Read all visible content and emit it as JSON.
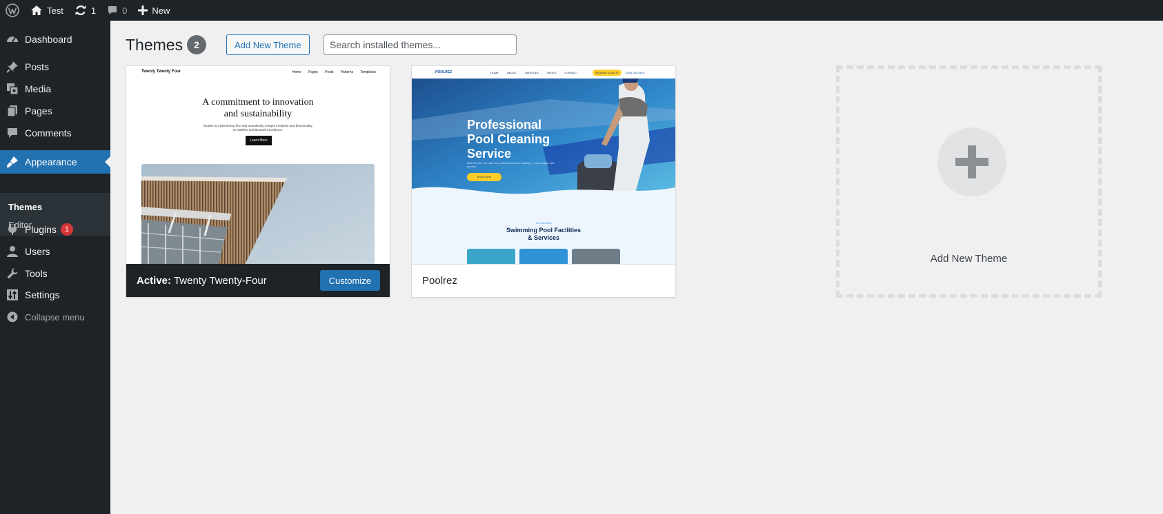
{
  "adminbar": {
    "site_name": "Test",
    "updates_count": "1",
    "comments_count": "0",
    "new_label": "New"
  },
  "sidebar": {
    "items": [
      {
        "label": "Dashboard",
        "icon": "dashboard-icon"
      },
      {
        "label": "Posts",
        "icon": "pushpin-icon"
      },
      {
        "label": "Media",
        "icon": "media-icon"
      },
      {
        "label": "Pages",
        "icon": "pages-icon"
      },
      {
        "label": "Comments",
        "icon": "comment-icon"
      },
      {
        "label": "Appearance",
        "icon": "paintbrush-icon"
      },
      {
        "label": "Plugins",
        "icon": "plug-icon",
        "badge": "1"
      },
      {
        "label": "Users",
        "icon": "user-icon"
      },
      {
        "label": "Tools",
        "icon": "wrench-icon"
      },
      {
        "label": "Settings",
        "icon": "settings-icon"
      }
    ],
    "submenu": [
      "Themes",
      "Editor"
    ],
    "collapse_label": "Collapse menu"
  },
  "header": {
    "title": "Themes",
    "count": "2",
    "add_button": "Add New Theme",
    "search_placeholder": "Search installed themes..."
  },
  "themes": [
    {
      "active_prefix": "Active:",
      "name": "Twenty Twenty-Four",
      "customize_label": "Customize",
      "preview": {
        "site_title": "Twenty Twenty Four",
        "nav": [
          "Home",
          "Pages",
          "Posts",
          "Patterns",
          "Templates"
        ],
        "heading_line1": "A commitment to innovation",
        "heading_line2": "and sustainability",
        "paragraph": "Études is a pioneering firm that seamlessly merges creativity and functionality to redefine architectural excellence.",
        "button": "Learn More"
      }
    },
    {
      "name": "Poolrez",
      "preview": {
        "logo": "POOLREZ",
        "nav": [
          "HOME",
          "ABOUT",
          "SERVICES",
          "PAGES",
          "CONTACT"
        ],
        "cta": "REQUEST A QUOTE",
        "phone": "(100) 234-5678",
        "hero_line1": "Professional",
        "hero_line2": "Pool Cleaning",
        "hero_line3": "Service",
        "hero_sub": "Dive into the fun, with our professional pool cleaning — at a budget rate service.",
        "hero_button": "BOOK NOW",
        "section_small": "Our Services",
        "section_line1": "Swimming Pool Facilities",
        "section_line2": "& Services"
      }
    }
  ],
  "add_theme_label": "Add New Theme",
  "colors": {
    "adminbar": "#1d2327",
    "accent": "#2271b1",
    "badge": "#d63638",
    "background": "#f0f0f1"
  }
}
